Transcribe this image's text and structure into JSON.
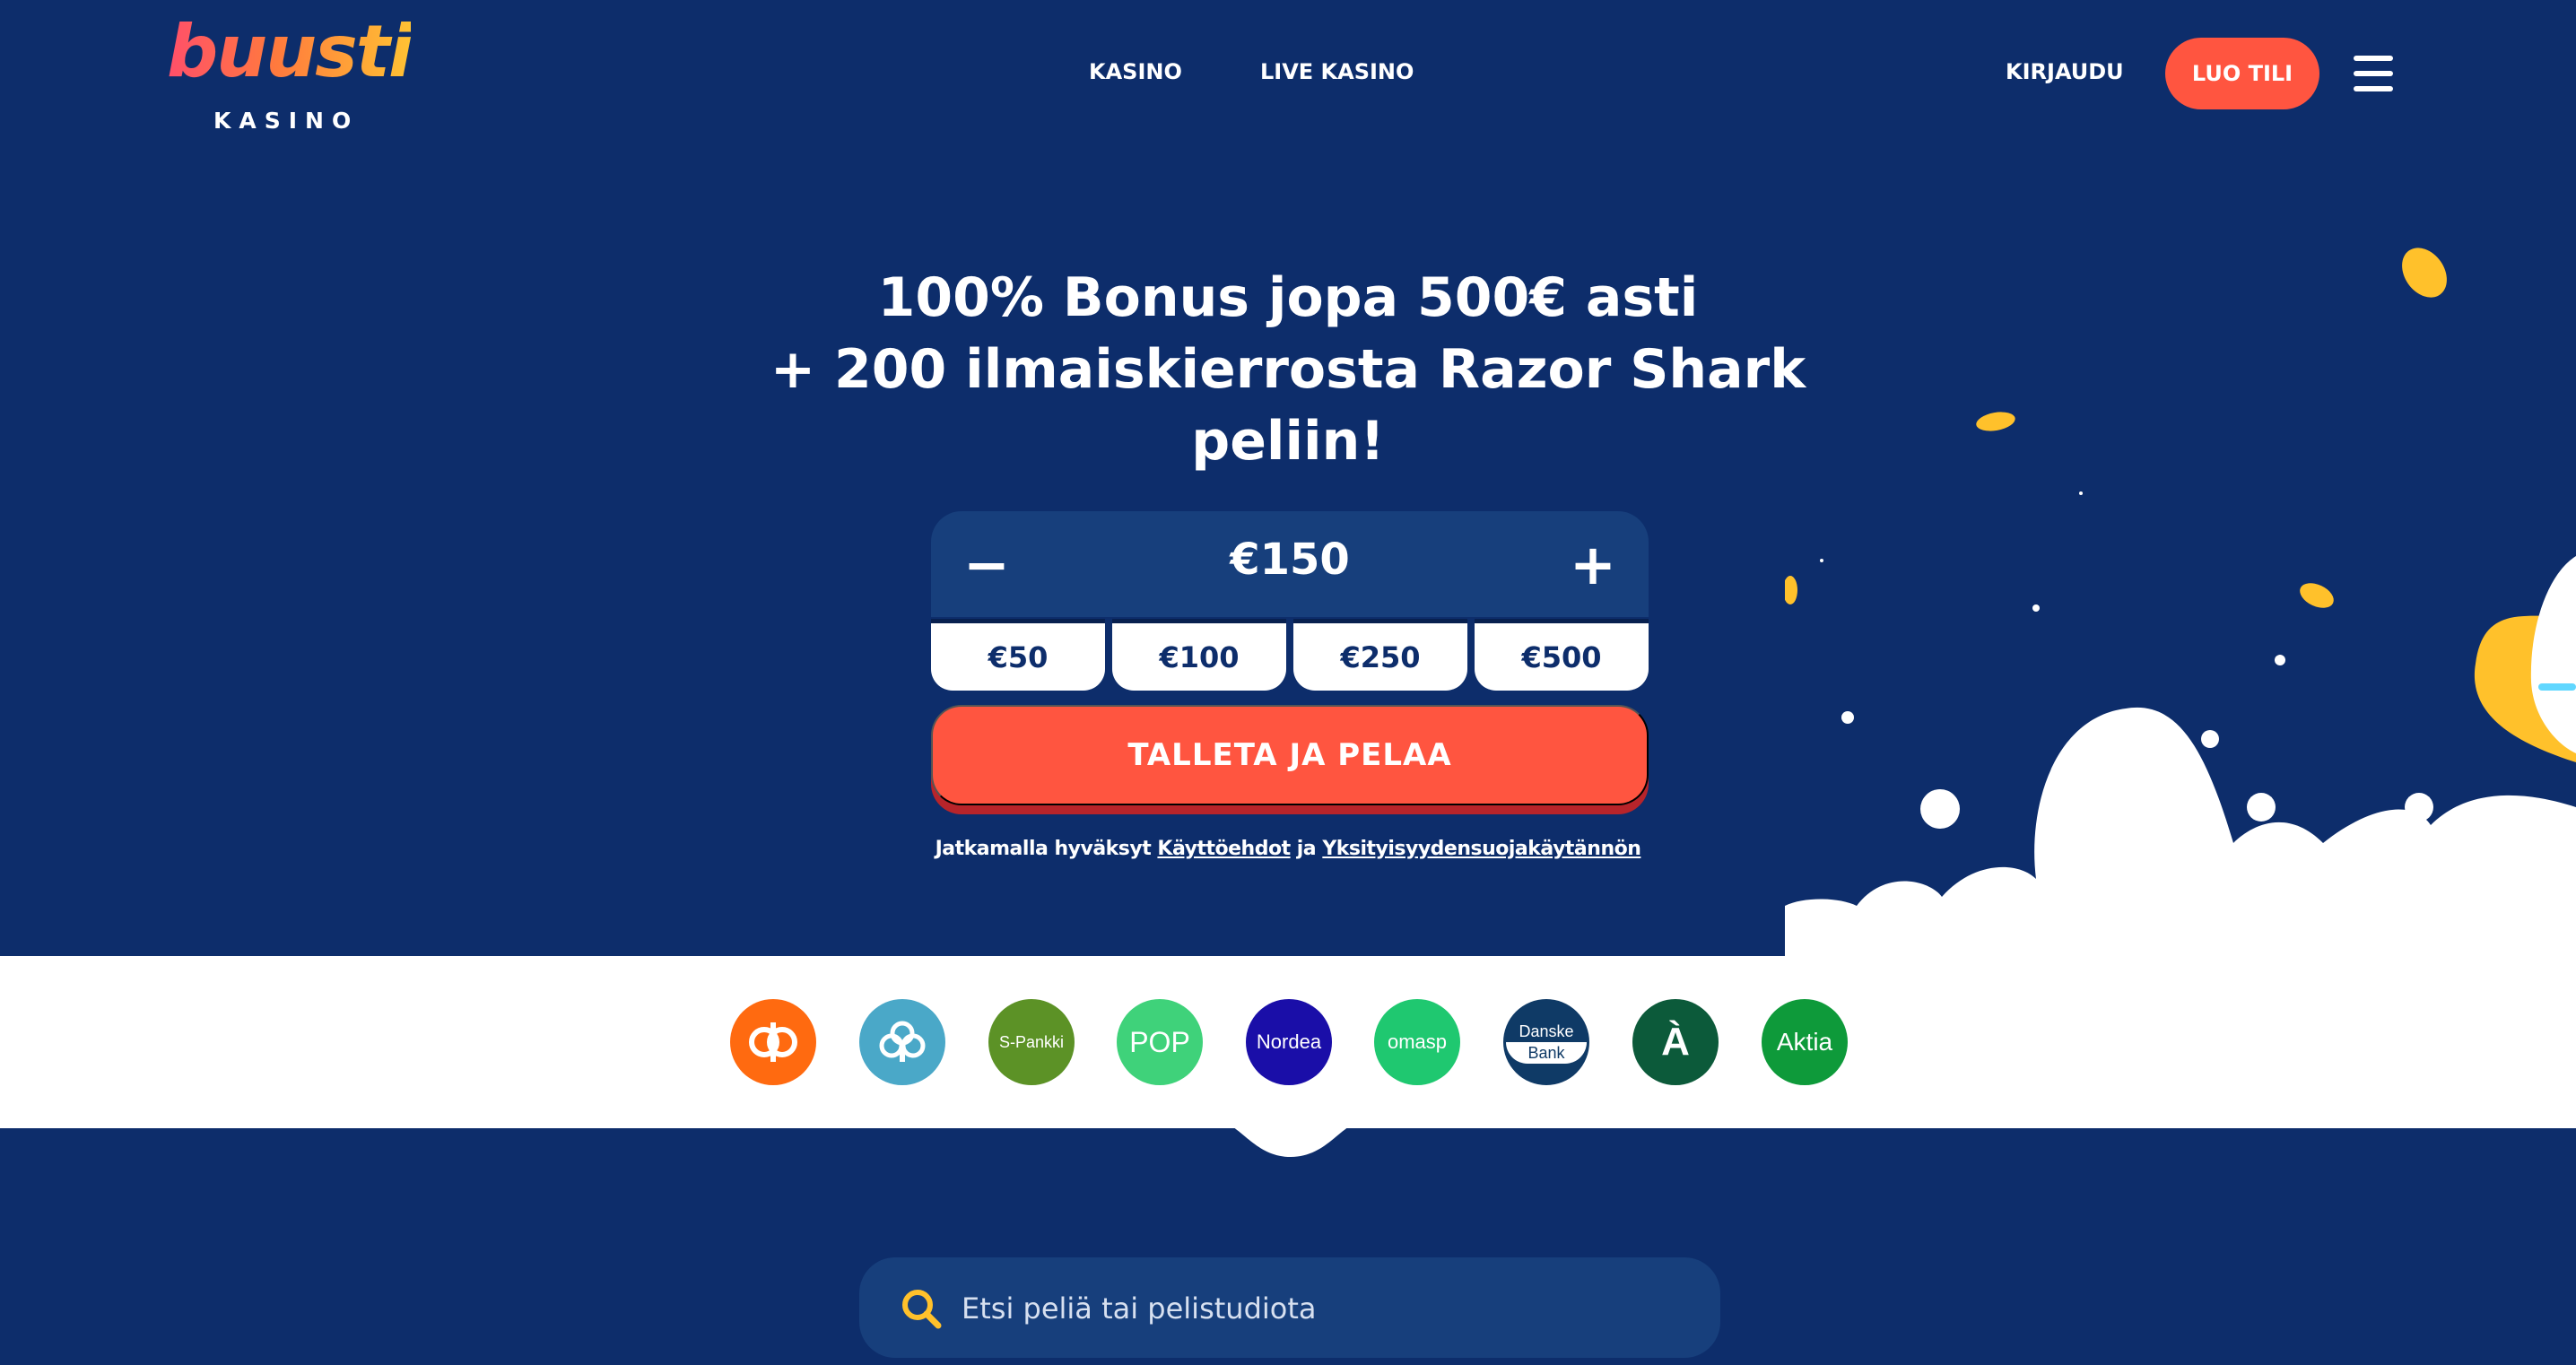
{
  "brand": {
    "logo_word": "buusti",
    "logo_sub": "KASINO"
  },
  "nav": {
    "kasino": "KASINO",
    "live_kasino": "LIVE KASINO",
    "login": "KIRJAUDU",
    "register": "LUO TILI"
  },
  "hero": {
    "title_line1": "100% Bonus jopa 500€ asti",
    "title_line2": "+ 200 ilmaiskierrosta Razor Shark",
    "title_line3": "peliin!",
    "amount": "€150",
    "minus": "−",
    "plus": "+",
    "presets": [
      "€50",
      "€100",
      "€250",
      "€500"
    ],
    "cta": "TALLETA JA PELAA",
    "terms_prefix": "Jatkamalla hyväksyt ",
    "terms_link": "Käyttöehdot",
    "terms_mid": " ja ",
    "privacy_link": "Yksityisyydensuojakäytännön"
  },
  "banks": [
    {
      "name": "op",
      "label": "",
      "color": "#ff6a10"
    },
    {
      "name": "saastopankki",
      "label": "",
      "color": "#4aa8c8"
    },
    {
      "name": "s-pankki",
      "label": "S-Pankki",
      "color": "#5c9226"
    },
    {
      "name": "pop",
      "label": "POP",
      "color": "#3fd27a"
    },
    {
      "name": "nordea",
      "label": "Nordea",
      "color": "#1a0ea8"
    },
    {
      "name": "omasp",
      "label": "omasp",
      "color": "#1fc870"
    },
    {
      "name": "danske",
      "label": "Danske",
      "label2": "Bank",
      "color": "#0f3a66"
    },
    {
      "name": "alandsbanken",
      "label": "À",
      "color": "#0c5a3a"
    },
    {
      "name": "aktia",
      "label": "Aktia",
      "color": "#0e9a3a"
    }
  ],
  "search": {
    "placeholder": "Etsi peliä tai pelistudiota"
  },
  "colors": {
    "bg": "#0d2d6b",
    "panel": "#173f7c",
    "accent": "#ff5540",
    "coin": "#ffc12b"
  }
}
